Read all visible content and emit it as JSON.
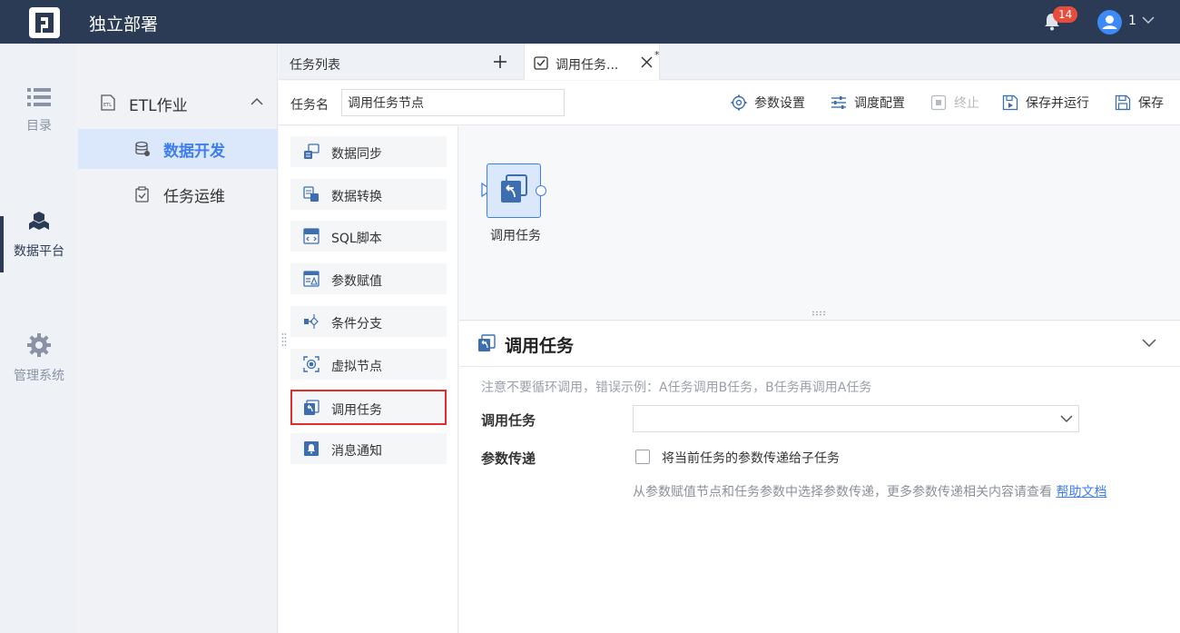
{
  "header": {
    "app_title": "独立部署",
    "notification_count": "14",
    "user_name": "1"
  },
  "leftnav": {
    "items": [
      {
        "label": "目录"
      },
      {
        "label": "数据平台"
      },
      {
        "label": "管理系统"
      }
    ]
  },
  "subnav": {
    "group_label": "ETL作业",
    "items": [
      {
        "label": "数据开发"
      },
      {
        "label": "任务运维"
      }
    ]
  },
  "tabs": {
    "list_label": "任务列表",
    "active_label": "调用任务...",
    "modified_mark": "*"
  },
  "toolbar": {
    "task_name_label": "任务名",
    "task_name_value": "调用任务节点",
    "param_settings": "参数设置",
    "schedule_config": "调度配置",
    "stop": "终止",
    "save_and_run": "保存并运行",
    "save": "保存"
  },
  "palette": {
    "items": [
      {
        "label": "数据同步"
      },
      {
        "label": "数据转换"
      },
      {
        "label": "SQL脚本"
      },
      {
        "label": "参数赋值"
      },
      {
        "label": "条件分支"
      },
      {
        "label": "虚拟节点"
      },
      {
        "label": "调用任务"
      },
      {
        "label": "消息通知"
      }
    ]
  },
  "canvas": {
    "node_label": "调用任务"
  },
  "panel": {
    "title": "调用任务",
    "note": "注意不要循环调用，错误示例：A任务调用B任务，B任务再调用A任务",
    "call_task_label": "调用任务",
    "call_task_value": "",
    "param_pass_label": "参数传递",
    "checkbox_label": "将当前任务的参数传递给子任务",
    "help_text": "从参数赋值节点和任务参数中选择参数传递，更多参数传递相关内容请查看",
    "help_link": "帮助文档"
  },
  "colors": {
    "topbar": "#2b3a55",
    "accent": "#3d7ef0",
    "badge": "#e84c3d",
    "highlight": "#e02d2d"
  }
}
